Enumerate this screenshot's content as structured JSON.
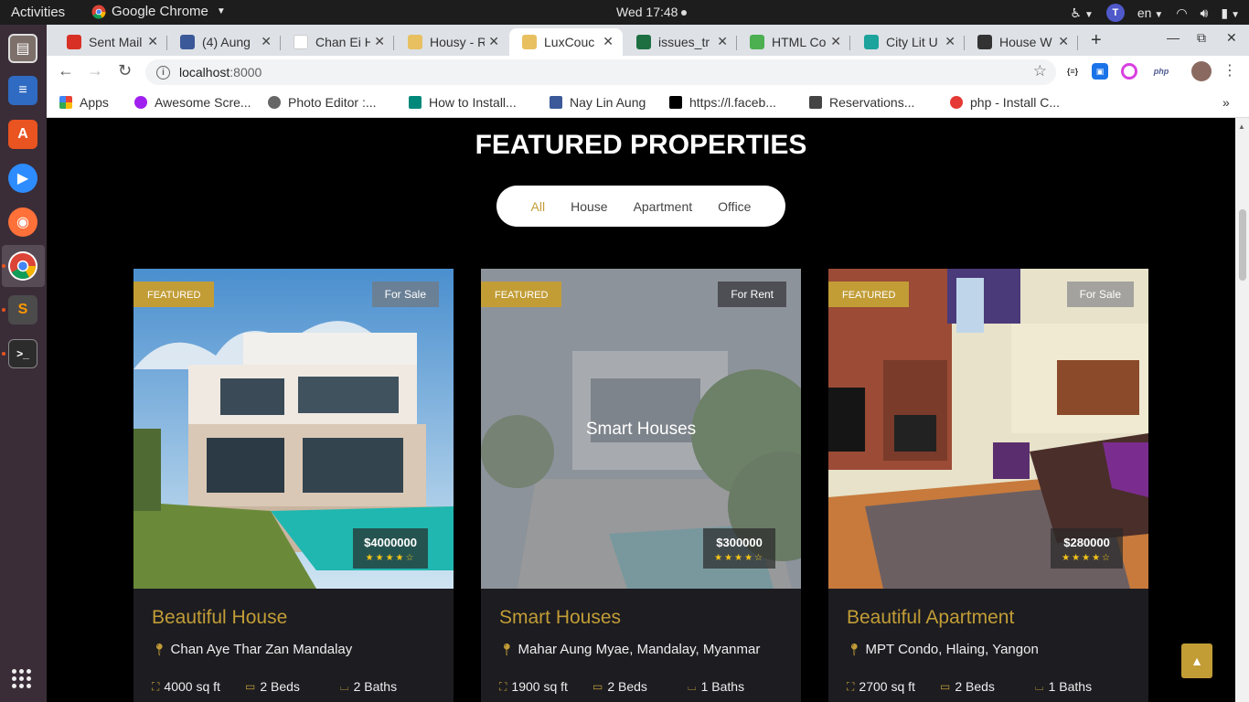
{
  "topbar": {
    "activities": "Activities",
    "app_name": "Google Chrome",
    "clock": "Wed 17:48",
    "language": "en"
  },
  "tabs": [
    {
      "title": "Sent Mail",
      "icon": "gmail-icon",
      "color": "#d93025"
    },
    {
      "title": "(4) Aung",
      "icon": "facebook-icon",
      "color": "#3b5998"
    },
    {
      "title": "Chan Ei H",
      "icon": "blank-page-icon",
      "color": "#ffffff"
    },
    {
      "title": "Housy - R",
      "icon": "housy-icon",
      "color": "#e8c060"
    },
    {
      "title": "LuxCouc",
      "icon": "luxcouch-icon",
      "color": "#e8c060"
    },
    {
      "title": "issues_tr",
      "icon": "excel-icon",
      "color": "#1d6f42"
    },
    {
      "title": "HTML Co",
      "icon": "w3schools-icon",
      "color": "#4caf50"
    },
    {
      "title": "City Lit U",
      "icon": "citylit-icon",
      "color": "#1ba39c"
    },
    {
      "title": "House W",
      "icon": "house-icon",
      "color": "#333333"
    }
  ],
  "address_bar": {
    "host": "localhost",
    "port": ":8000"
  },
  "bookmarks": [
    {
      "label": "Apps",
      "icon": "apps-grid-icon"
    },
    {
      "label": "Awesome Scre...",
      "icon": "awesome-screenshot-icon"
    },
    {
      "label": "Photo Editor :...",
      "icon": "photo-editor-icon"
    },
    {
      "label": "How to Install...",
      "icon": "ut-icon"
    },
    {
      "label": "Nay Lin Aung",
      "icon": "facebook-icon"
    },
    {
      "label": "https://l.faceb...",
      "icon": "medium-icon"
    },
    {
      "label": "Reservations...",
      "icon": "box-icon"
    },
    {
      "label": "php - Install C...",
      "icon": "ask-icon"
    }
  ],
  "extensions": [
    "json-viewer-icon",
    "extension-icon",
    "color-picker-icon",
    "php-icon",
    "profile-avatar"
  ],
  "page": {
    "section_title": "FEATURED PROPERTIES",
    "filters": [
      "All",
      "House",
      "Apartment",
      "Office"
    ],
    "active_filter": "All",
    "accent_color": "#c29d36",
    "properties": [
      {
        "badge": "FEATURED",
        "status": "For Sale",
        "price": "$4000000",
        "rating": 4,
        "stars": "★★★★☆",
        "overlay": "",
        "name": "Beautiful House",
        "address": "Chan Aye Thar Zan Mandalay",
        "area": "4000 sq ft",
        "beds": "2 Beds",
        "baths": "2 Baths"
      },
      {
        "badge": "FEATURED",
        "status": "For Rent",
        "price": "$300000",
        "rating": 4,
        "stars": "★★★★☆",
        "overlay": "Smart Houses",
        "name": "Smart Houses",
        "address": "Mahar Aung Myae, Mandalay, Myanmar",
        "area": "1900 sq ft",
        "beds": "2 Beds",
        "baths": "1 Baths"
      },
      {
        "badge": "FEATURED",
        "status": "For Sale",
        "price": "$280000",
        "rating": 4,
        "stars": "★★★★☆",
        "overlay": "",
        "name": "Beautiful Apartment",
        "address": "MPT Condo, Hlaing, Yangon",
        "area": "2700 sq ft",
        "beds": "2 Beds",
        "baths": "1 Baths"
      }
    ]
  }
}
